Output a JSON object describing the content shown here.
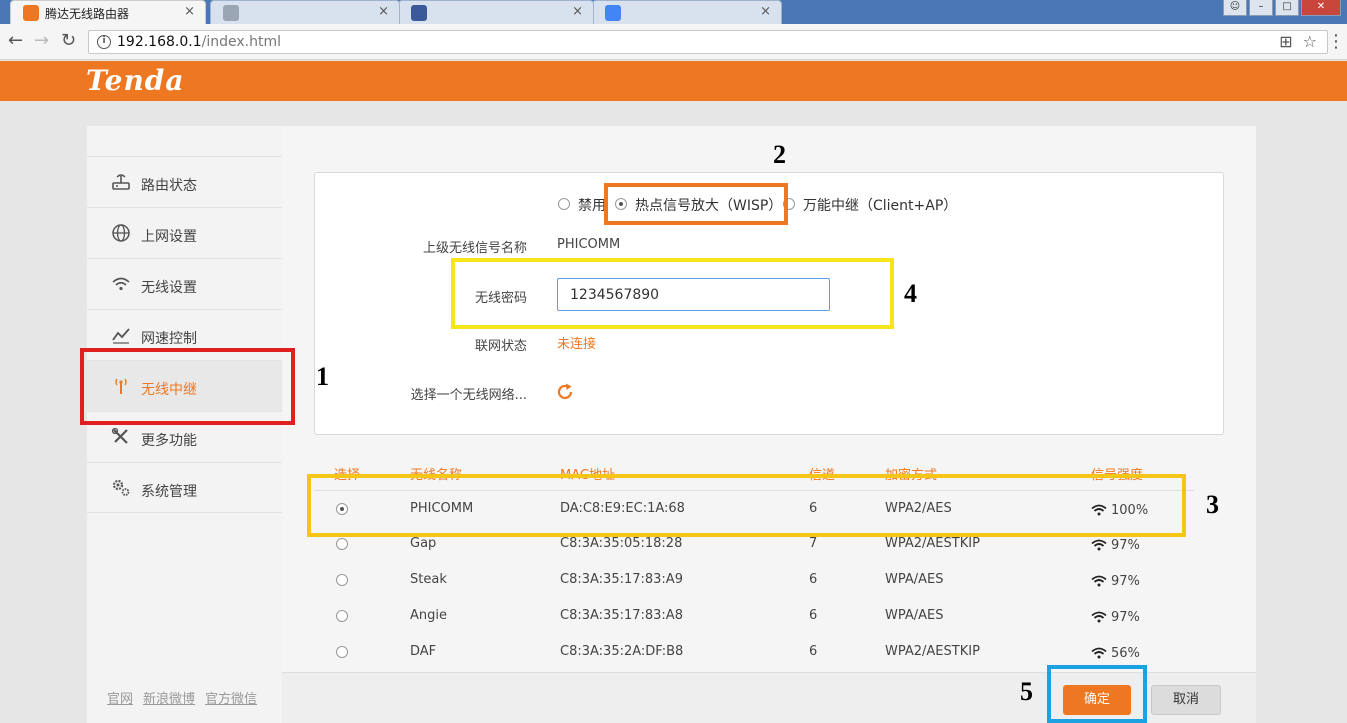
{
  "browser": {
    "tabs": [
      {
        "title": "腾达无线路由器",
        "active": true
      },
      {
        "title": "",
        "active": false
      },
      {
        "title": "",
        "active": false
      },
      {
        "title": "",
        "active": false
      },
      {
        "title": "",
        "active": false
      }
    ],
    "url_host": "192.168.0.1",
    "url_path": "/index.html"
  },
  "brand": {
    "logo": "Tenda",
    "accent": "#ee7722"
  },
  "sidebar": {
    "items": [
      {
        "label": "路由状态",
        "icon": "router-icon"
      },
      {
        "label": "上网设置",
        "icon": "globe-icon"
      },
      {
        "label": "无线设置",
        "icon": "wifi-icon"
      },
      {
        "label": "网速控制",
        "icon": "speed-chart-icon"
      },
      {
        "label": "无线中继",
        "icon": "signal-tower-icon",
        "active": true
      },
      {
        "label": "更多功能",
        "icon": "tools-icon"
      },
      {
        "label": "系统管理",
        "icon": "gears-icon"
      }
    ],
    "footer": [
      "官网",
      "新浪微博",
      "官方微信"
    ]
  },
  "repeater": {
    "modes": {
      "disable": "禁用",
      "wisp": "热点信号放大（WISP）",
      "client_ap": "万能中继（Client+AP）",
      "selected": "wisp"
    },
    "upstream_ssid_label": "上级无线信号名称",
    "upstream_ssid_value": "PHICOMM",
    "password_label": "无线密码",
    "password_value": "1234567890",
    "status_label": "联网状态",
    "status_value": "未连接",
    "choose_label": "选择一个无线网络...",
    "refresh_icon": "refresh-icon"
  },
  "networks": {
    "headers": {
      "select": "选择",
      "ssid": "无线名称",
      "mac": "MAC地址",
      "channel": "信道",
      "security": "加密方式",
      "signal": "信号强度"
    },
    "rows": [
      {
        "ssid": "PHICOMM",
        "mac": "DA:C8:E9:EC:1A:68",
        "channel": "6",
        "security": "WPA2/AES",
        "signal": "100%",
        "selected": true
      },
      {
        "ssid": "Gap",
        "mac": "C8:3A:35:05:18:28",
        "channel": "7",
        "security": "WPA2/AESTKIP",
        "signal": "97%",
        "selected": false
      },
      {
        "ssid": "Steak",
        "mac": "C8:3A:35:17:83:A9",
        "channel": "6",
        "security": "WPA/AES",
        "signal": "97%",
        "selected": false
      },
      {
        "ssid": "Angie",
        "mac": "C8:3A:35:17:83:A8",
        "channel": "6",
        "security": "WPA/AES",
        "signal": "97%",
        "selected": false
      },
      {
        "ssid": "DAF",
        "mac": "C8:3A:35:2A:DF:B8",
        "channel": "6",
        "security": "WPA2/AESTKIP",
        "signal": "56%",
        "selected": false
      }
    ]
  },
  "actions": {
    "ok": "确定",
    "cancel": "取消"
  },
  "annotations": [
    {
      "number": "1",
      "color": "#e02020"
    },
    {
      "number": "2",
      "color": "#ee7722"
    },
    {
      "number": "3",
      "color": "#f5c518"
    },
    {
      "number": "4",
      "color": "#f5e51a"
    },
    {
      "number": "5",
      "color": "#1aa3e0"
    }
  ]
}
